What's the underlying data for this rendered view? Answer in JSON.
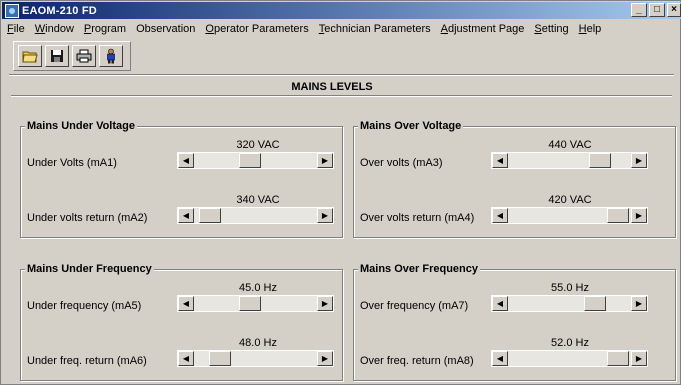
{
  "window": {
    "title": "EAOM-210 FD"
  },
  "menu": [
    "File",
    "Window",
    "Program",
    "Observation",
    "Operator Parameters",
    "Technician Parameters",
    "Adjustment Page",
    "Setting",
    "Help"
  ],
  "toolbar": {
    "icons": [
      "open-folder-icon",
      "save-icon",
      "print-icon",
      "person-icon"
    ]
  },
  "page": {
    "title": "MAINS LEVELS"
  },
  "groups": {
    "under_voltage": {
      "title": "Mains Under Voltage",
      "rows": [
        {
          "label": "Under Volts (mA1)",
          "value": "320 VAC",
          "level": 0.45
        },
        {
          "label": "Under volts return (mA2)",
          "value": "340 VAC",
          "level": 0.05
        }
      ]
    },
    "over_voltage": {
      "title": "Mains Over Voltage",
      "rows": [
        {
          "label": "Over volts (mA3)",
          "value": "440 VAC",
          "level": 0.8
        },
        {
          "label": "Over volts return (mA4)",
          "value": "420 VAC",
          "level": 0.98
        }
      ]
    },
    "under_frequency": {
      "title": "Mains Under Frequency",
      "rows": [
        {
          "label": "Under frequency (mA5)",
          "value": "45.0 Hz",
          "level": 0.45
        },
        {
          "label": "Under freq. return (mA6)",
          "value": "48.0 Hz",
          "level": 0.15
        }
      ]
    },
    "over_frequency": {
      "title": "Mains Over Frequency",
      "rows": [
        {
          "label": "Over frequency (mA7)",
          "value": "55.0 Hz",
          "level": 0.75
        },
        {
          "label": "Over freq. return (mA8)",
          "value": "52.0 Hz",
          "level": 0.98
        }
      ]
    }
  }
}
